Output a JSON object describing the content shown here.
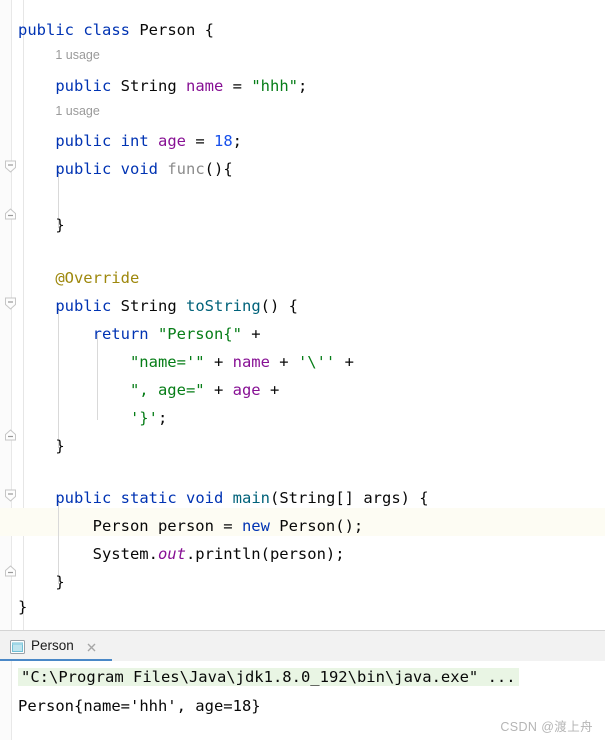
{
  "app": {
    "name": "IntelliJ IDEA",
    "theme": "light",
    "colors": {
      "keyword": "#0033B3",
      "string": "#067D17",
      "number": "#1750EB",
      "field": "#871094",
      "annotation": "#9E880D",
      "method_declaration": "#00627A",
      "unused_method": "#8C8C8C",
      "static_field": "#871094",
      "plain_text": "#080808",
      "caret_line": "#FDFCF3",
      "hint_text": "#9A9A9A",
      "console_command_highlight": "#E9F5E4",
      "tab_underline": "#4A88C7"
    }
  },
  "editor": {
    "file": "Person",
    "hints": [
      {
        "text": "1 usage",
        "line": 2
      },
      {
        "text": "1 usage",
        "line": 4
      }
    ],
    "lines": [
      {
        "n": 1,
        "indent": 0,
        "tokens": [
          {
            "t": "public",
            "c": "kw"
          },
          {
            "t": " ",
            "c": "plain"
          },
          {
            "t": "class",
            "c": "kw"
          },
          {
            "t": " Person {",
            "c": "plain"
          }
        ]
      },
      {
        "n": 3,
        "indent": 1,
        "tokens": [
          {
            "t": "public",
            "c": "kw"
          },
          {
            "t": " ",
            "c": "plain"
          },
          {
            "t": "String",
            "c": "plain"
          },
          {
            "t": " ",
            "c": "plain"
          },
          {
            "t": "name",
            "c": "fld"
          },
          {
            "t": " = ",
            "c": "plain"
          },
          {
            "t": "\"hhh\"",
            "c": "str"
          },
          {
            "t": ";",
            "c": "plain"
          }
        ]
      },
      {
        "n": 5,
        "indent": 1,
        "tokens": [
          {
            "t": "public",
            "c": "kw"
          },
          {
            "t": " ",
            "c": "plain"
          },
          {
            "t": "int",
            "c": "kw"
          },
          {
            "t": " ",
            "c": "plain"
          },
          {
            "t": "age",
            "c": "fld"
          },
          {
            "t": " = ",
            "c": "plain"
          },
          {
            "t": "18",
            "c": "num"
          },
          {
            "t": ";",
            "c": "plain"
          }
        ]
      },
      {
        "n": 6,
        "indent": 1,
        "tokens": [
          {
            "t": "public",
            "c": "kw"
          },
          {
            "t": " ",
            "c": "plain"
          },
          {
            "t": "void",
            "c": "kw"
          },
          {
            "t": " ",
            "c": "plain"
          },
          {
            "t": "func",
            "c": "mgray"
          },
          {
            "t": "(){",
            "c": "plain"
          }
        ]
      },
      {
        "n": 7,
        "indent": 1,
        "tokens": []
      },
      {
        "n": 8,
        "indent": 1,
        "tokens": [
          {
            "t": "}",
            "c": "plain"
          }
        ]
      },
      {
        "n": 9,
        "indent": 0,
        "tokens": []
      },
      {
        "n": 10,
        "indent": 1,
        "tokens": [
          {
            "t": "@Override",
            "c": "anno"
          }
        ]
      },
      {
        "n": 11,
        "indent": 1,
        "tokens": [
          {
            "t": "public",
            "c": "kw"
          },
          {
            "t": " ",
            "c": "plain"
          },
          {
            "t": "String",
            "c": "plain"
          },
          {
            "t": " ",
            "c": "plain"
          },
          {
            "t": "toString",
            "c": "mdecl"
          },
          {
            "t": "() {",
            "c": "plain"
          }
        ]
      },
      {
        "n": 12,
        "indent": 2,
        "tokens": [
          {
            "t": "return",
            "c": "kw"
          },
          {
            "t": " ",
            "c": "plain"
          },
          {
            "t": "\"Person{\"",
            "c": "str"
          },
          {
            "t": " +",
            "c": "plain"
          }
        ]
      },
      {
        "n": 13,
        "indent": 3,
        "tokens": [
          {
            "t": "\"name='\"",
            "c": "str"
          },
          {
            "t": " + ",
            "c": "plain"
          },
          {
            "t": "name",
            "c": "fld"
          },
          {
            "t": " + ",
            "c": "plain"
          },
          {
            "t": "'\\''",
            "c": "str"
          },
          {
            "t": " +",
            "c": "plain"
          }
        ]
      },
      {
        "n": 14,
        "indent": 3,
        "tokens": [
          {
            "t": "\", age=\"",
            "c": "str"
          },
          {
            "t": " + ",
            "c": "plain"
          },
          {
            "t": "age",
            "c": "fld"
          },
          {
            "t": " +",
            "c": "plain"
          }
        ]
      },
      {
        "n": 15,
        "indent": 3,
        "tokens": [
          {
            "t": "'}'",
            "c": "str"
          },
          {
            "t": ";",
            "c": "plain"
          }
        ]
      },
      {
        "n": 16,
        "indent": 1,
        "tokens": [
          {
            "t": "}",
            "c": "plain"
          }
        ]
      },
      {
        "n": 17,
        "indent": 0,
        "tokens": []
      },
      {
        "n": 18,
        "indent": 1,
        "tokens": [
          {
            "t": "public",
            "c": "kw"
          },
          {
            "t": " ",
            "c": "plain"
          },
          {
            "t": "static",
            "c": "kw"
          },
          {
            "t": " ",
            "c": "plain"
          },
          {
            "t": "void",
            "c": "kw"
          },
          {
            "t": " ",
            "c": "plain"
          },
          {
            "t": "main",
            "c": "mdecl"
          },
          {
            "t": "(String[] args) {",
            "c": "plain"
          }
        ]
      },
      {
        "n": 19,
        "indent": 2,
        "caret": true,
        "tokens": [
          {
            "t": "Person person = ",
            "c": "plain"
          },
          {
            "t": "new",
            "c": "kw"
          },
          {
            "t": " Person();",
            "c": "plain"
          }
        ]
      },
      {
        "n": 20,
        "indent": 2,
        "tokens": [
          {
            "t": "System.",
            "c": "plain"
          },
          {
            "t": "out",
            "c": "stat"
          },
          {
            "t": ".println(person);",
            "c": "plain"
          }
        ]
      },
      {
        "n": 21,
        "indent": 1,
        "tokens": [
          {
            "t": "}",
            "c": "plain"
          }
        ]
      },
      {
        "n": 22,
        "indent": 0,
        "tokens": [
          {
            "t": "}",
            "c": "plain"
          }
        ]
      }
    ],
    "fold_markers": [
      {
        "type": "collapse",
        "line": 6
      },
      {
        "type": "end",
        "line": 8
      },
      {
        "type": "collapse",
        "line": 11
      },
      {
        "type": "end",
        "line": 16
      },
      {
        "type": "collapse",
        "line": 18
      },
      {
        "type": "end",
        "line": 21
      }
    ]
  },
  "console": {
    "tab": {
      "label": "Person",
      "icon": "console-icon",
      "close_icon": "close-icon",
      "active": true
    },
    "command_line": "\"C:\\Program Files\\Java\\jdk1.8.0_192\\bin\\java.exe\" ...",
    "output_line": "Person{name='hhh', age=18}"
  },
  "watermark": "CSDN @渡上舟"
}
